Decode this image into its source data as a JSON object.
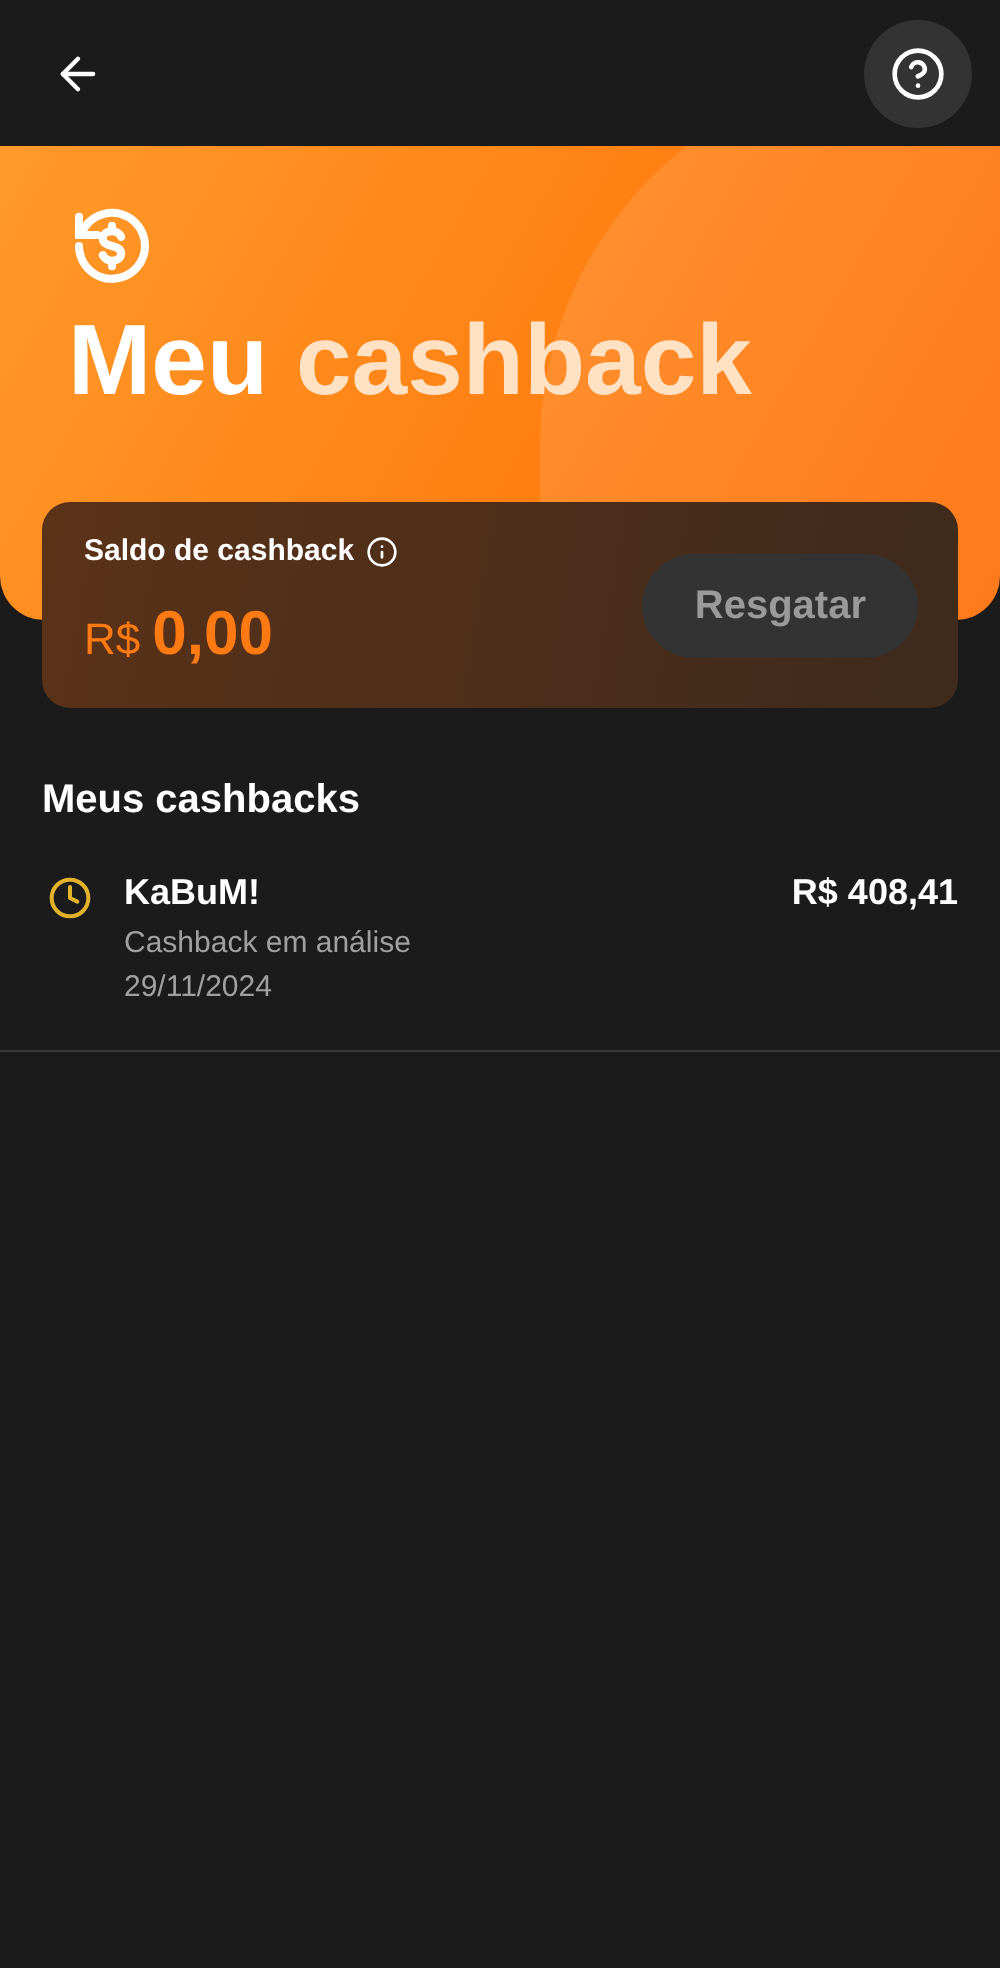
{
  "banner": {
    "title_main": "Meu",
    "title_accent": "cashback"
  },
  "balance": {
    "label": "Saldo de cashback",
    "currency": "R$",
    "amount": "0,00",
    "button": {
      "label": "Resgatar",
      "disabled": true
    }
  },
  "section_title": "Meus cashbacks",
  "items": [
    {
      "kind": "pending",
      "store": "KaBuM!",
      "status": "Cashback em análise",
      "date": "29/11/2024",
      "amount": "R$ 408,41"
    }
  ]
}
